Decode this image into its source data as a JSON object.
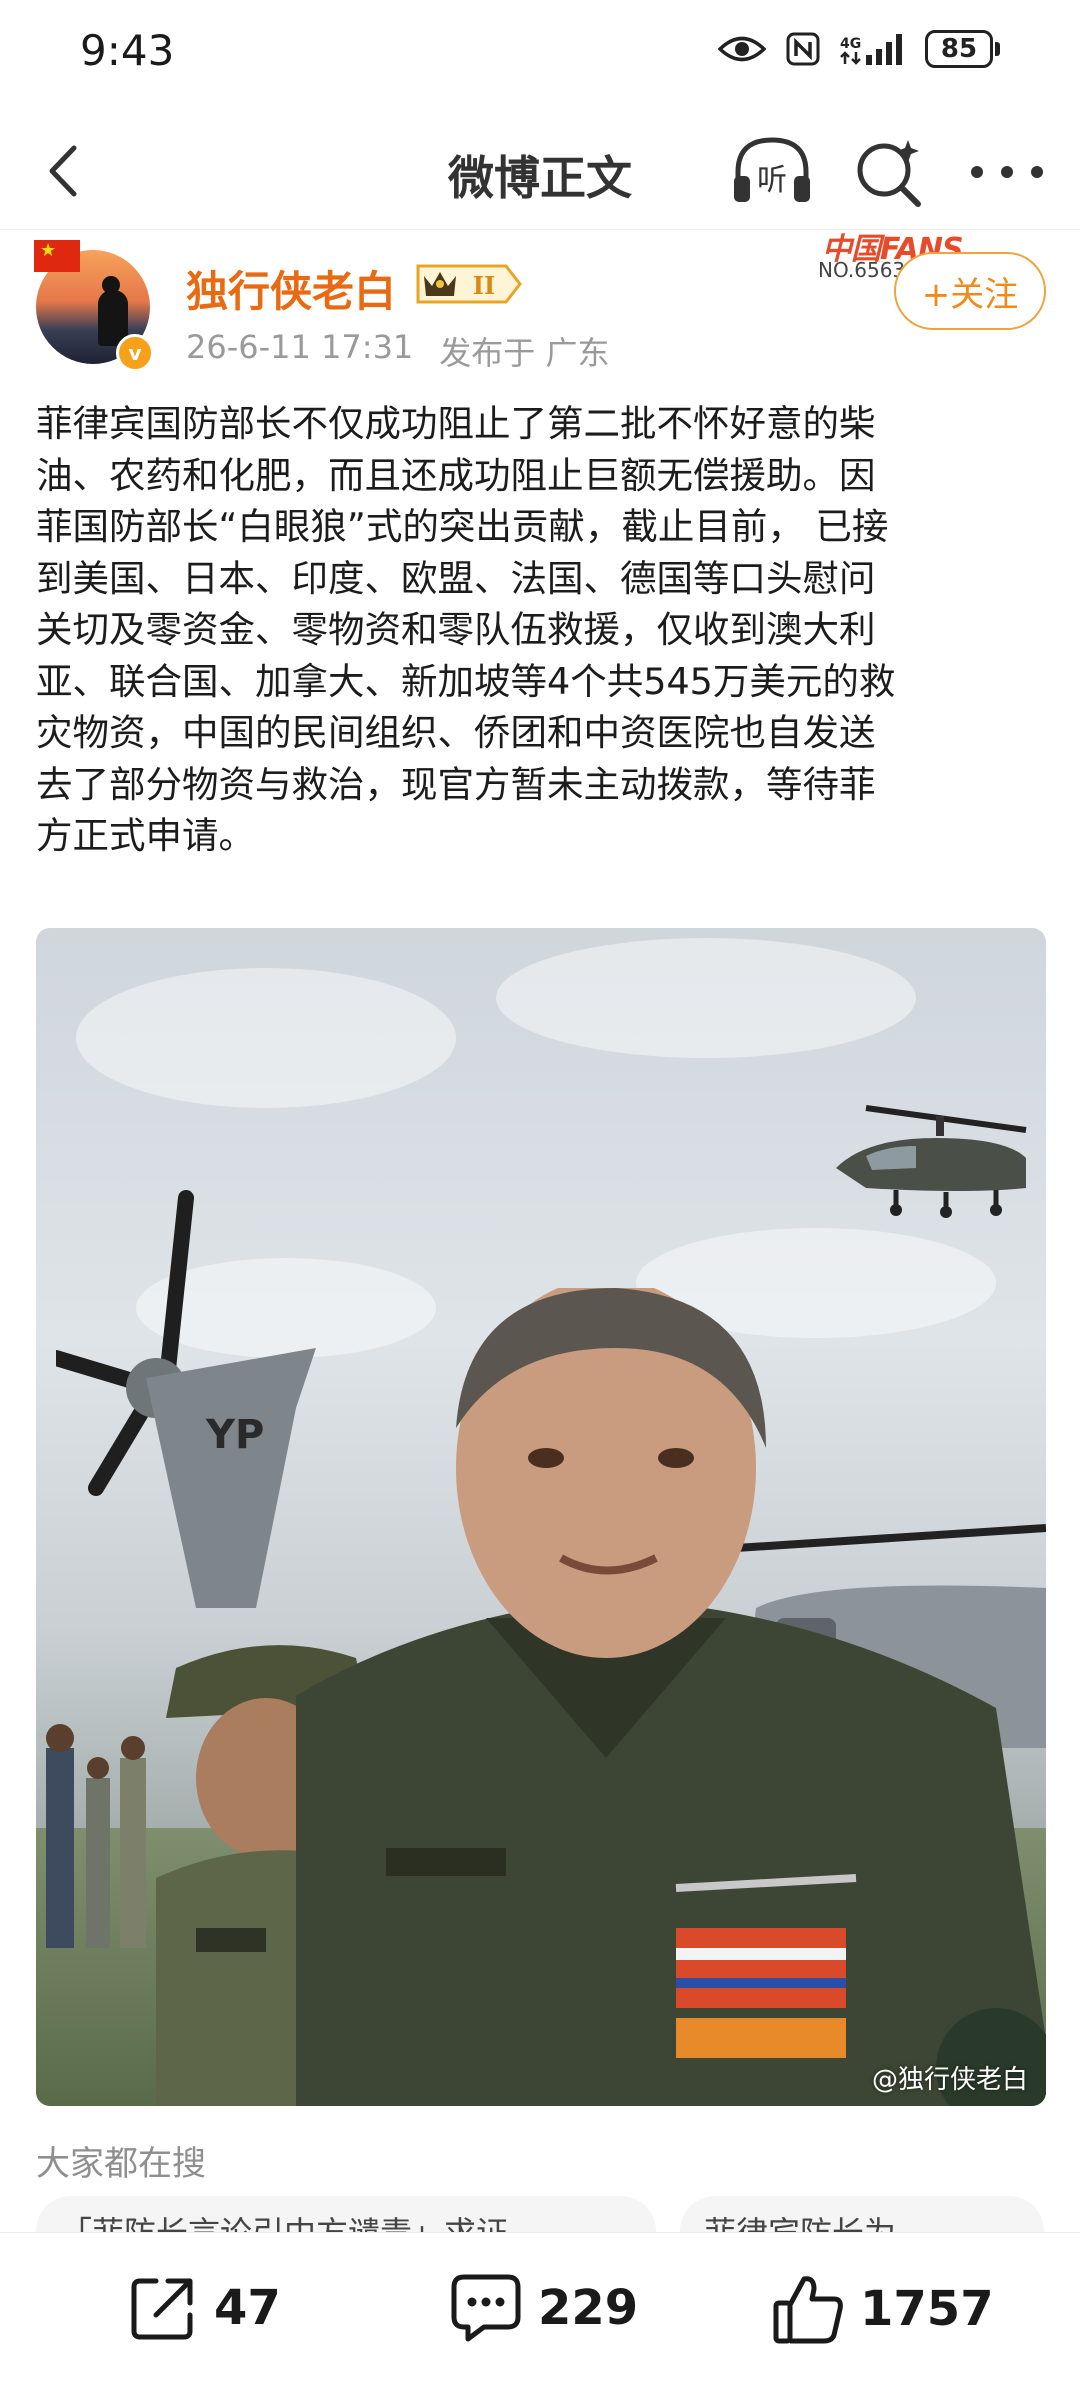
{
  "status_bar": {
    "time": "9:43",
    "network_label": "4G",
    "battery": "85",
    "icons": [
      "eye-icon",
      "nfc-icon",
      "signal-icon",
      "battery-icon"
    ]
  },
  "nav": {
    "title": "微博正文",
    "listen_label": "听",
    "icons": [
      "back-arrow-icon",
      "listen-icon",
      "search-icon",
      "more-icon"
    ]
  },
  "post": {
    "author": "独行侠老白",
    "level_badge": "II",
    "timestamp": "26-6-11 17:31",
    "location": "发布于 广东",
    "fans_badge_title": "中国FANS",
    "fans_badge_no": "NO.6563",
    "follow_label": "+关注",
    "text": "菲律宾国防部长不仅成功阻止了第二批不怀好意的柴\n油、农药和化肥，而且还成功阻止巨额无偿援助。因\n菲国防部长“白眼狼”式的突出贡献，截止目前， 已接\n到美国、日本、印度、欧盟、法国、德国等口头慰问\n关切及零资金、零物资和零队伍救援，仅收到澳大利\n亚、联合国、加拿大、新加坡等4个共545万美元的救\n灾物资，中国的民间组织、侨团和中资医院也自发送\n去了部分物资与救治，现官方暂未主动拨款，等待菲\n方正式申请。",
    "photo_watermark": "@独行侠老白"
  },
  "trending": {
    "title": "大家都在搜",
    "chips": [
      "「菲防长言论引中方谴责」求证",
      "菲律宾防长为"
    ]
  },
  "actions": {
    "share_count": "47",
    "comment_count": "229",
    "like_count": "1757"
  },
  "colors": {
    "username": "#e86a12",
    "follow_border": "#f0a23b",
    "meta_gray": "#9a9a9a"
  }
}
